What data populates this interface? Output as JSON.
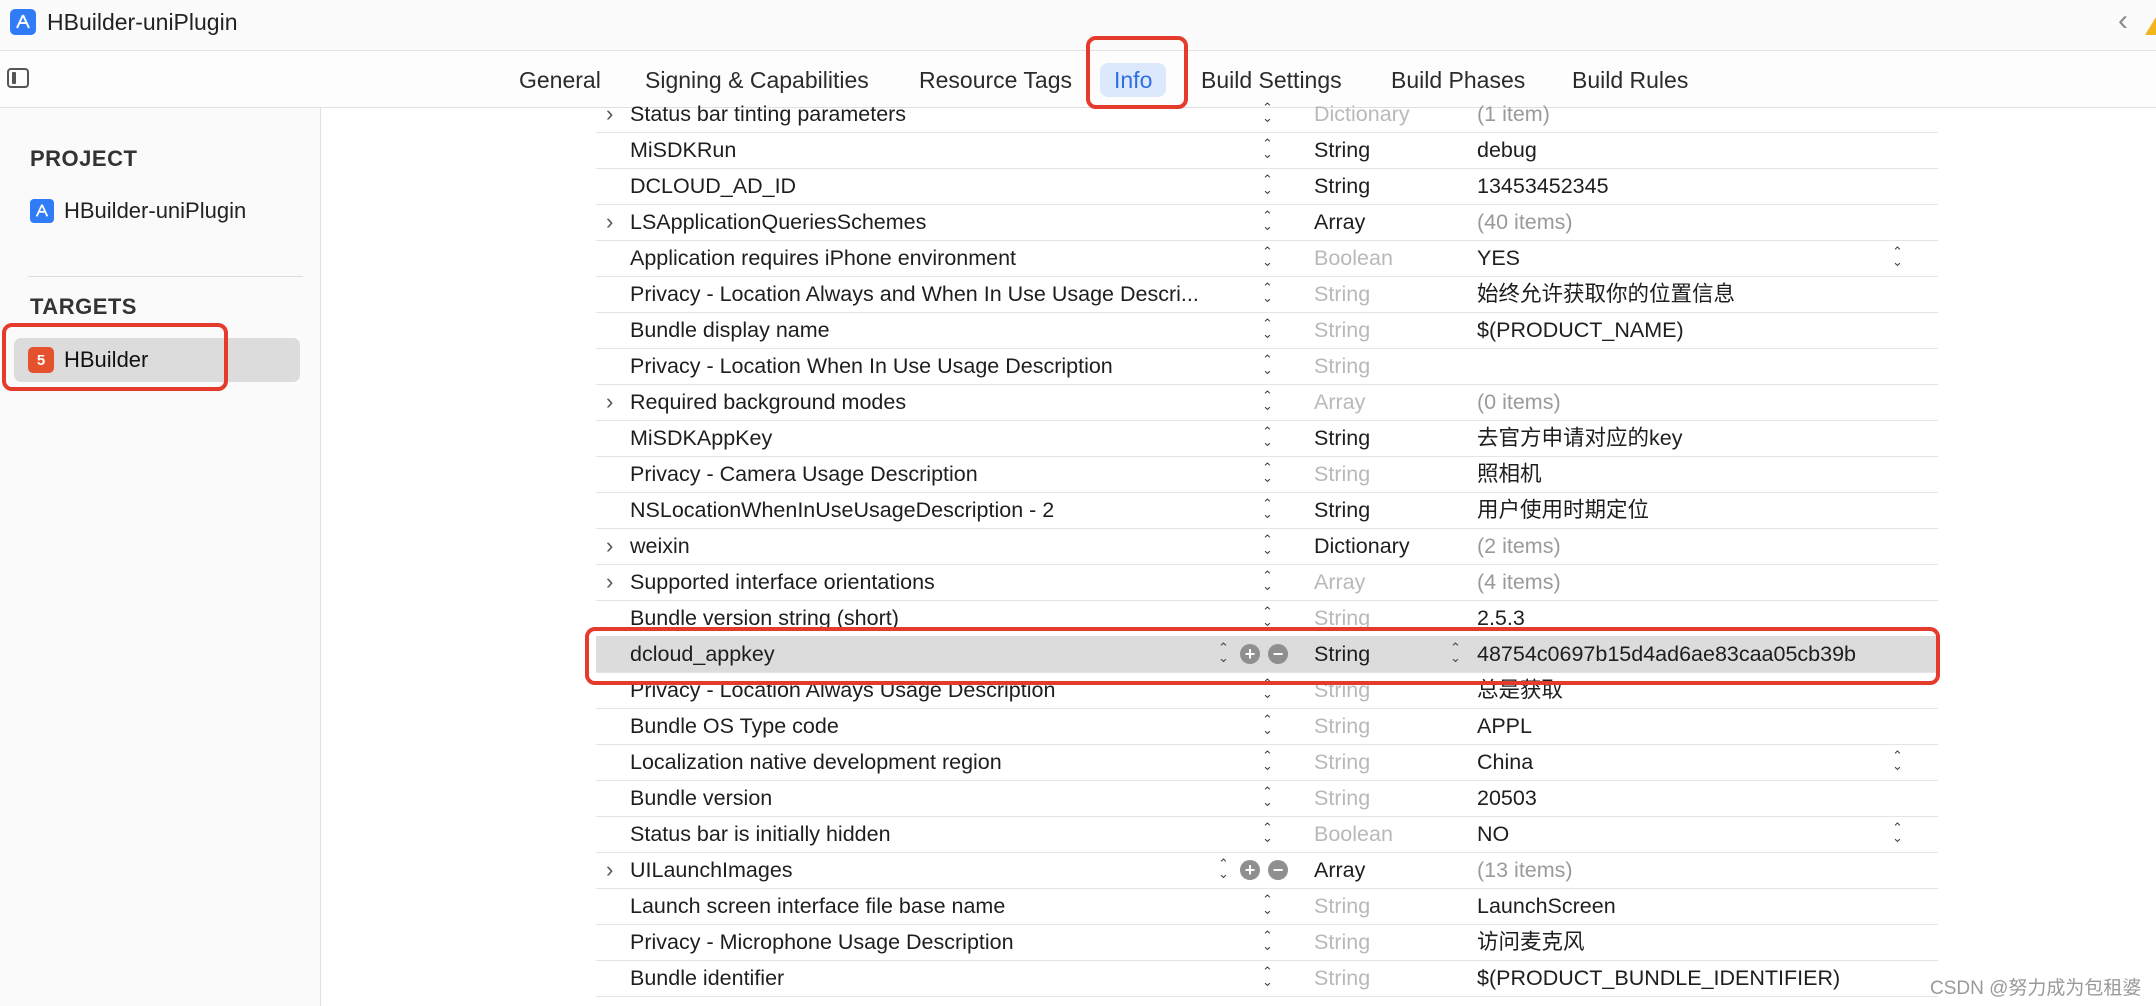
{
  "app": {
    "title": "HBuilder-uniPlugin"
  },
  "tabs": [
    {
      "label": "General"
    },
    {
      "label": "Signing & Capabilities"
    },
    {
      "label": "Resource Tags"
    },
    {
      "label": "Info"
    },
    {
      "label": "Build Settings"
    },
    {
      "label": "Build Phases"
    },
    {
      "label": "Build Rules"
    }
  ],
  "sidebar": {
    "project_heading": "PROJECT",
    "project_item": "HBuilder-uniPlugin",
    "targets_heading": "TARGETS",
    "target_item": "HBuilder"
  },
  "plist": [
    {
      "key": "Status bar tinting parameters",
      "type": "Dictionary",
      "value": "(1 item)",
      "expandable": true,
      "dim_type": true,
      "dim_value": true
    },
    {
      "key": "MiSDKRun",
      "type": "String",
      "value": "debug"
    },
    {
      "key": "DCLOUD_AD_ID",
      "type": "String",
      "value": "13453452345"
    },
    {
      "key": "LSApplicationQueriesSchemes",
      "type": "Array",
      "value": "(40 items)",
      "expandable": true,
      "dim_value": true
    },
    {
      "key": "Application requires iPhone environment",
      "type": "Boolean",
      "value": "YES",
      "dim_type": true,
      "value_stepper": true
    },
    {
      "key": "Privacy - Location Always and When In Use Usage Descri...",
      "type": "String",
      "value": "始终允许获取你的位置信息",
      "dim_type": true
    },
    {
      "key": "Bundle display name",
      "type": "String",
      "value": "$(PRODUCT_NAME)",
      "dim_type": true
    },
    {
      "key": "Privacy - Location When In Use Usage Description",
      "type": "String",
      "value": "",
      "dim_type": true
    },
    {
      "key": "Required background modes",
      "type": "Array",
      "value": "(0 items)",
      "expandable": true,
      "dim_type": true,
      "dim_value": true
    },
    {
      "key": "MiSDKAppKey",
      "type": "String",
      "value": "去官方申请对应的key"
    },
    {
      "key": "Privacy - Camera Usage Description",
      "type": "String",
      "value": "照相机",
      "dim_type": true
    },
    {
      "key": "NSLocationWhenInUseUsageDescription - 2",
      "type": "String",
      "value": "用户使用时期定位"
    },
    {
      "key": "weixin",
      "type": "Dictionary",
      "value": "(2 items)",
      "expandable": true,
      "dim_value": true
    },
    {
      "key": "Supported interface orientations",
      "type": "Array",
      "value": "(4 items)",
      "expandable": true,
      "dim_type": true,
      "dim_value": true
    },
    {
      "key": "Bundle version string (short)",
      "type": "String",
      "value": "2.5.3",
      "dim_type": true
    },
    {
      "key": "dcloud_appkey",
      "type": "String",
      "value": "48754c0697b15d4ad6ae83caa05cb39b",
      "selected": true
    },
    {
      "key": "Privacy - Location Always Usage Description",
      "type": "String",
      "value": "总是获取",
      "dim_type": true
    },
    {
      "key": "Bundle OS Type code",
      "type": "String",
      "value": "APPL",
      "dim_type": true
    },
    {
      "key": "Localization native development region",
      "type": "String",
      "value": "China",
      "dim_type": true,
      "value_stepper": true
    },
    {
      "key": "Bundle version",
      "type": "String",
      "value": "20503",
      "dim_type": true
    },
    {
      "key": "Status bar is initially hidden",
      "type": "Boolean",
      "value": "NO",
      "dim_type": true,
      "value_stepper": true
    },
    {
      "key": "UILaunchImages",
      "type": "Array",
      "value": "(13 items)",
      "expandable": true,
      "dim_value": true,
      "hover": true
    },
    {
      "key": "Launch screen interface file base name",
      "type": "String",
      "value": "LaunchScreen",
      "dim_type": true
    },
    {
      "key": "Privacy - Microphone Usage Description",
      "type": "String",
      "value": "访问麦克风",
      "dim_type": true
    },
    {
      "key": "Bundle identifier",
      "type": "String",
      "value": "$(PRODUCT_BUNDLE_IDENTIFIER)",
      "dim_type": true
    }
  ],
  "watermark": "CSDN @努力成为包租婆",
  "colors": {
    "accent": "#2f6fe0",
    "highlight": "#e53b2c",
    "selected_row": "#dcdcdc"
  }
}
